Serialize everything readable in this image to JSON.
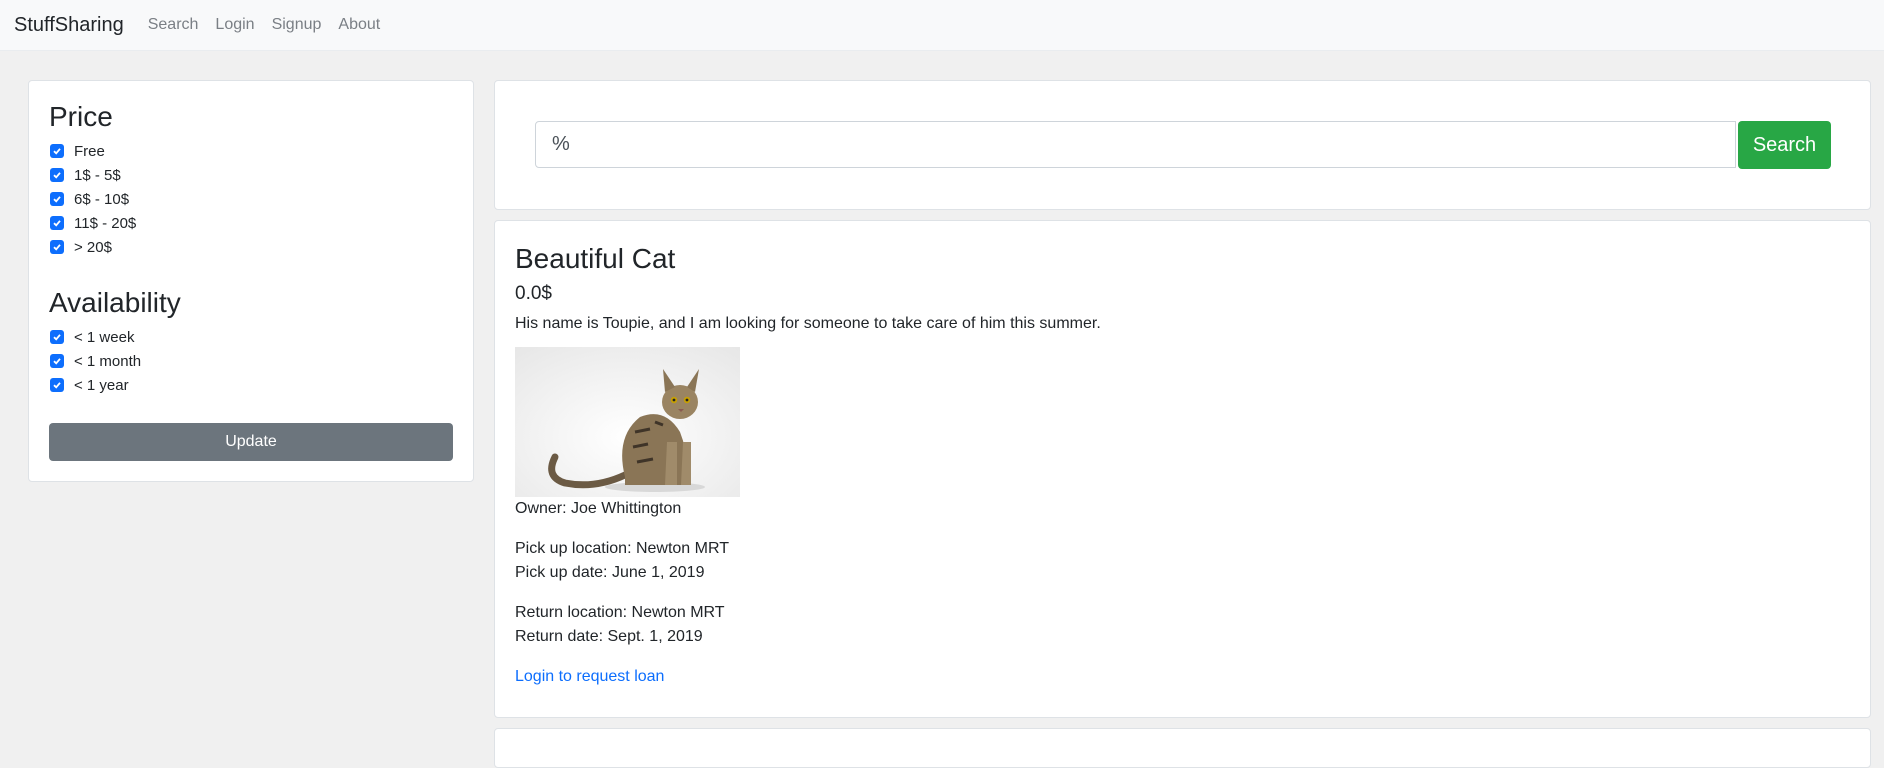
{
  "nav": {
    "brand": "StuffSharing",
    "links": [
      "Search",
      "Login",
      "Signup",
      "About"
    ]
  },
  "filters": {
    "price_title": "Price",
    "price_options": [
      {
        "label": "Free",
        "checked": true
      },
      {
        "label": "1$ - 5$",
        "checked": true
      },
      {
        "label": "6$ - 10$",
        "checked": true
      },
      {
        "label": "11$ - 20$",
        "checked": true
      },
      {
        "label": "> 20$",
        "checked": true
      }
    ],
    "availability_title": "Availability",
    "availability_options": [
      {
        "label": "< 1 week",
        "checked": true
      },
      {
        "label": "< 1 month",
        "checked": true
      },
      {
        "label": "< 1 year",
        "checked": true
      }
    ],
    "update_label": "Update"
  },
  "search": {
    "value": "%",
    "button_label": "Search"
  },
  "item": {
    "title": "Beautiful Cat",
    "price": "0.0$",
    "description": "His name is Toupie, and I am looking for someone to take care of him this summer.",
    "owner": "Owner: Joe Whittington",
    "pickup_location": "Pick up location: Newton MRT",
    "pickup_date": "Pick up date: June 1, 2019",
    "return_location": "Return location: Newton MRT",
    "return_date": "Return date: Sept. 1, 2019",
    "loan_link": "Login to request loan"
  },
  "colors": {
    "checkbox": "#0d6efd",
    "update_button": "#6c757d",
    "search_button": "#28a745",
    "link": "#0d6efd"
  }
}
